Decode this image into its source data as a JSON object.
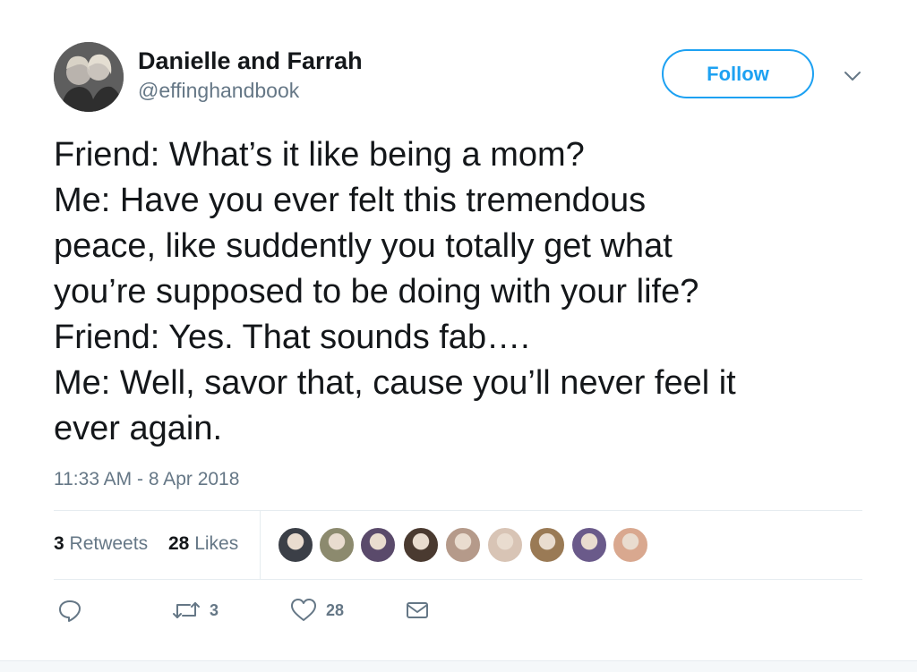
{
  "author": {
    "name": "Danielle and Farrah",
    "handle": "@effinghandbook"
  },
  "follow_label": "Follow",
  "tweet_lines": [
    "Friend: What’s it like being a mom?",
    "Me: Have you ever felt this tremendous",
    "peace, like suddently you totally get what",
    "you’re supposed to be doing with your life?",
    "Friend: Yes. That sounds fab….",
    "Me: Well, savor that, cause you’ll never feel it",
    "ever again."
  ],
  "timestamp": "11:33 AM - 8 Apr 2018",
  "stats": {
    "retweets_count": "3",
    "retweets_label": "Retweets",
    "likes_count": "28",
    "likes_label": "Likes"
  },
  "likers_avatar_colors": [
    "#3b3f47",
    "#8c8a6e",
    "#5a4a6b",
    "#4a3a30",
    "#b59a8a",
    "#d8c4b5",
    "#9a7a55",
    "#6a5a8a",
    "#d9a88f"
  ],
  "actions": {
    "reply_icon": "reply-icon",
    "retweet_icon": "retweet-icon",
    "retweet_count": "3",
    "like_icon": "heart-icon",
    "like_count": "28",
    "message_icon": "envelope-icon"
  },
  "colors": {
    "accent": "#1da1f2",
    "secondary_text": "#657786",
    "primary_text": "#14171a",
    "divider": "#e6ecf0"
  }
}
